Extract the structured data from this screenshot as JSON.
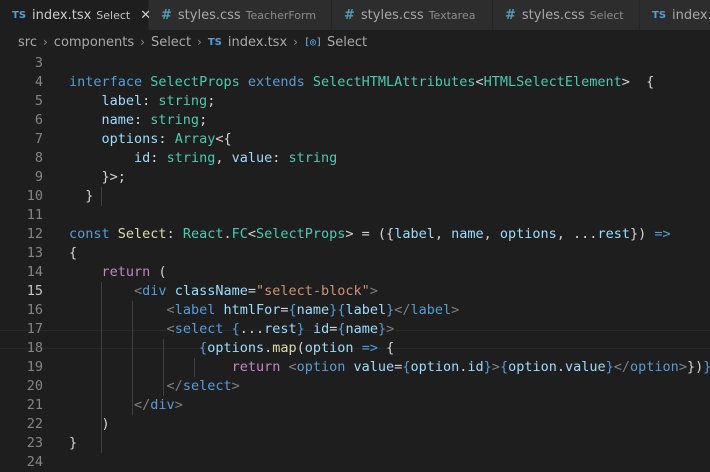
{
  "tabs": [
    {
      "icon": "TS",
      "name": "index.tsx",
      "desc": "Select",
      "active": true,
      "close": "✕"
    },
    {
      "icon": "#",
      "name": "styles.css",
      "desc": "TeacherForm",
      "active": false
    },
    {
      "icon": "#",
      "name": "styles.css",
      "desc": "Textarea",
      "active": false
    },
    {
      "icon": "#",
      "name": "styles.css",
      "desc": "Select",
      "active": false
    },
    {
      "icon": "TS",
      "name": "index.tsx",
      "desc": "",
      "active": false
    }
  ],
  "breadcrumb": {
    "parts": [
      "src",
      "components",
      "Select"
    ],
    "file_icon": "TS",
    "file": "index.tsx",
    "symbol_icon": "[◎]",
    "symbol": "Select",
    "separator": "›"
  },
  "editor": {
    "current_line": 15,
    "lines": [
      {
        "n": "3",
        "tokens": []
      },
      {
        "n": "4",
        "tokens": [
          [
            "kw",
            "interface"
          ],
          [
            "pl",
            " "
          ],
          [
            "ty",
            "SelectProps"
          ],
          [
            "pl",
            " "
          ],
          [
            "kw",
            "extends"
          ],
          [
            "pl",
            " "
          ],
          [
            "ty",
            "SelectHTMLAttributes"
          ],
          [
            "pl",
            "<"
          ],
          [
            "ty",
            "HTMLSelectElement"
          ],
          [
            "pl",
            ">  {"
          ]
        ]
      },
      {
        "n": "5",
        "tokens": [
          [
            "pl",
            "    "
          ],
          [
            "pr",
            "label"
          ],
          [
            "pl",
            ": "
          ],
          [
            "ty",
            "string"
          ],
          [
            "pl",
            ";"
          ]
        ]
      },
      {
        "n": "6",
        "tokens": [
          [
            "pl",
            "    "
          ],
          [
            "pr",
            "name"
          ],
          [
            "pl",
            ": "
          ],
          [
            "ty",
            "string"
          ],
          [
            "pl",
            ";"
          ]
        ]
      },
      {
        "n": "7",
        "tokens": [
          [
            "pl",
            "    "
          ],
          [
            "pr",
            "options"
          ],
          [
            "pl",
            ": "
          ],
          [
            "ty",
            "Array"
          ],
          [
            "pl",
            "<{"
          ]
        ]
      },
      {
        "n": "8",
        "tokens": [
          [
            "pl",
            "        "
          ],
          [
            "pr",
            "id"
          ],
          [
            "pl",
            ": "
          ],
          [
            "ty",
            "string"
          ],
          [
            "pl",
            ", "
          ],
          [
            "pr",
            "value"
          ],
          [
            "pl",
            ": "
          ],
          [
            "ty",
            "string"
          ]
        ]
      },
      {
        "n": "9",
        "tokens": [
          [
            "pl",
            "    }>;"
          ]
        ]
      },
      {
        "n": "10",
        "tokens": [
          [
            "pl",
            "  }"
          ]
        ]
      },
      {
        "n": "11",
        "tokens": []
      },
      {
        "n": "12",
        "tokens": [
          [
            "kw",
            "const"
          ],
          [
            "pl",
            " "
          ],
          [
            "fn",
            "Select"
          ],
          [
            "pl",
            ": "
          ],
          [
            "ty",
            "React"
          ],
          [
            "pl",
            "."
          ],
          [
            "ty",
            "FC"
          ],
          [
            "pl",
            "<"
          ],
          [
            "ty",
            "SelectProps"
          ],
          [
            "pl",
            "> = ({"
          ],
          [
            "pr",
            "label"
          ],
          [
            "pl",
            ", "
          ],
          [
            "pr",
            "name"
          ],
          [
            "pl",
            ", "
          ],
          [
            "pr",
            "options"
          ],
          [
            "pl",
            ", ..."
          ],
          [
            "pr",
            "rest"
          ],
          [
            "pl",
            "}) "
          ],
          [
            "kw",
            "=>"
          ]
        ]
      },
      {
        "n": "13",
        "tokens": [
          [
            "pl",
            "{"
          ]
        ]
      },
      {
        "n": "14",
        "tokens": [
          [
            "pl",
            "    "
          ],
          [
            "kc",
            "return"
          ],
          [
            "pl",
            " ("
          ]
        ]
      },
      {
        "n": "15",
        "tokens": [
          [
            "pl",
            "        "
          ],
          [
            "pu",
            "<"
          ],
          [
            "tg",
            "div"
          ],
          [
            "pl",
            " "
          ],
          [
            "pr",
            "className"
          ],
          [
            "pl",
            "="
          ],
          [
            "st",
            "\"select-block\""
          ],
          [
            "pu",
            ">"
          ]
        ]
      },
      {
        "n": "16",
        "tokens": [
          [
            "pl",
            "            "
          ],
          [
            "pu",
            "<"
          ],
          [
            "tg",
            "label"
          ],
          [
            "pl",
            " "
          ],
          [
            "pr",
            "htmlFor"
          ],
          [
            "pl",
            "="
          ],
          [
            "kw",
            "{"
          ],
          [
            "pr",
            "name"
          ],
          [
            "kw",
            "}"
          ],
          [
            "kw",
            "{"
          ],
          [
            "pr",
            "label"
          ],
          [
            "kw",
            "}"
          ],
          [
            "pu",
            "</"
          ],
          [
            "tg",
            "label"
          ],
          [
            "pu",
            ">"
          ]
        ]
      },
      {
        "n": "17",
        "tokens": [
          [
            "pl",
            "            "
          ],
          [
            "pu",
            "<"
          ],
          [
            "tg",
            "select"
          ],
          [
            "pl",
            " "
          ],
          [
            "kw",
            "{"
          ],
          [
            "pl",
            "..."
          ],
          [
            "pr",
            "rest"
          ],
          [
            "kw",
            "}"
          ],
          [
            "pl",
            " "
          ],
          [
            "pr",
            "id"
          ],
          [
            "pl",
            "="
          ],
          [
            "kw",
            "{"
          ],
          [
            "pr",
            "name"
          ],
          [
            "kw",
            "}"
          ],
          [
            "pu",
            ">"
          ]
        ]
      },
      {
        "n": "18",
        "tokens": [
          [
            "pl",
            "                "
          ],
          [
            "kw",
            "{"
          ],
          [
            "pr",
            "options"
          ],
          [
            "pl",
            "."
          ],
          [
            "fn",
            "map"
          ],
          [
            "pl",
            "("
          ],
          [
            "pr",
            "option"
          ],
          [
            "pl",
            " "
          ],
          [
            "kw",
            "=>"
          ],
          [
            "pl",
            " {"
          ]
        ]
      },
      {
        "n": "19",
        "tokens": [
          [
            "pl",
            "                    "
          ],
          [
            "kc",
            "return"
          ],
          [
            "pl",
            " "
          ],
          [
            "pu",
            "<"
          ],
          [
            "tg",
            "option"
          ],
          [
            "pl",
            " "
          ],
          [
            "pr",
            "value"
          ],
          [
            "pl",
            "="
          ],
          [
            "kw",
            "{"
          ],
          [
            "pr",
            "option"
          ],
          [
            "pl",
            "."
          ],
          [
            "pr",
            "id"
          ],
          [
            "kw",
            "}"
          ],
          [
            "pu",
            ">"
          ],
          [
            "kw",
            "{"
          ],
          [
            "pr",
            "option"
          ],
          [
            "pl",
            "."
          ],
          [
            "pr",
            "value"
          ],
          [
            "kw",
            "}"
          ],
          [
            "pu",
            "</"
          ],
          [
            "tg",
            "option"
          ],
          [
            "pu",
            ">"
          ],
          [
            "pl",
            "})"
          ],
          [
            "kw",
            "}"
          ]
        ]
      },
      {
        "n": "20",
        "tokens": [
          [
            "pl",
            "            "
          ],
          [
            "pu",
            "</"
          ],
          [
            "tg",
            "select"
          ],
          [
            "pu",
            ">"
          ]
        ]
      },
      {
        "n": "21",
        "tokens": [
          [
            "pl",
            "        "
          ],
          [
            "pu",
            "</"
          ],
          [
            "tg",
            "div"
          ],
          [
            "pu",
            ">"
          ]
        ]
      },
      {
        "n": "22",
        "tokens": [
          [
            "pl",
            "    )"
          ]
        ]
      },
      {
        "n": "23",
        "tokens": [
          [
            "pl",
            "}"
          ]
        ]
      },
      {
        "n": "24",
        "tokens": []
      }
    ]
  },
  "colors": {
    "keyword": "#569cd6",
    "control": "#c586c0",
    "type": "#4ec9b0",
    "property": "#9cdcfe",
    "function": "#dcdcaa",
    "string": "#ce9178",
    "background": "#1e1e1e"
  }
}
